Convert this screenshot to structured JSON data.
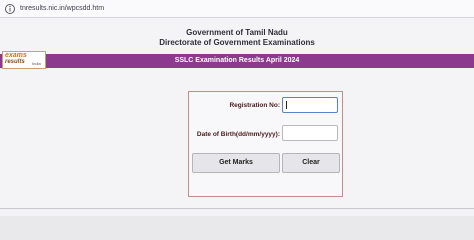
{
  "browser": {
    "url": "tnresults.nic.in/wpcsdd.htm"
  },
  "header": {
    "line1": "Government of Tamil Nadu",
    "line2": "Directorate of Government Examinations"
  },
  "logo": {
    "text_top": "exams",
    "text_bottom": "results",
    "text_sub": "India"
  },
  "banner": {
    "title": "SSLC  Examination Results  April 2024",
    "color": "#8c3a8e"
  },
  "form": {
    "registration_label": "Registration No:",
    "registration_value": "",
    "dob_label": "Date of Birth(dd/mm/yyyy):",
    "dob_value": "",
    "get_marks_label": "Get Marks",
    "clear_label": "Clear"
  }
}
